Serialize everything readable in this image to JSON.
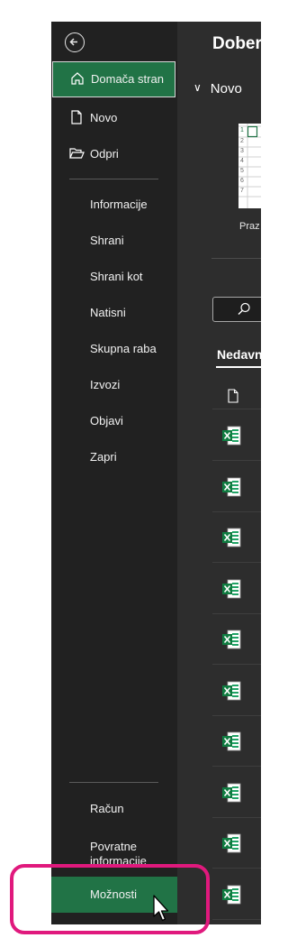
{
  "sidebar": {
    "items": [
      {
        "label": "Domača stran",
        "icon": "home-icon"
      },
      {
        "label": "Novo",
        "icon": "new-file-icon"
      },
      {
        "label": "Odpri",
        "icon": "folder-open-icon"
      },
      {
        "label": "Informacije"
      },
      {
        "label": "Shrani"
      },
      {
        "label": "Shrani kot"
      },
      {
        "label": "Natisni"
      },
      {
        "label": "Skupna raba"
      },
      {
        "label": "Izvozi"
      },
      {
        "label": "Objavi"
      },
      {
        "label": "Zapri"
      }
    ],
    "bottom_items": [
      {
        "label": "Račun"
      },
      {
        "label": "Povratne informacije"
      },
      {
        "label": "Možnosti"
      }
    ]
  },
  "main": {
    "greeting": "Dober",
    "new_section": "Novo",
    "template_label": "Praz",
    "recent_tab": "Nedavn",
    "thumb_rows": [
      "1",
      "2",
      "3",
      "4",
      "5",
      "6",
      "7"
    ]
  },
  "colors": {
    "sidebar_bg": "#212121",
    "accent_green": "#217346",
    "main_bg": "#2d2d2d",
    "highlight": "#e0197d"
  }
}
